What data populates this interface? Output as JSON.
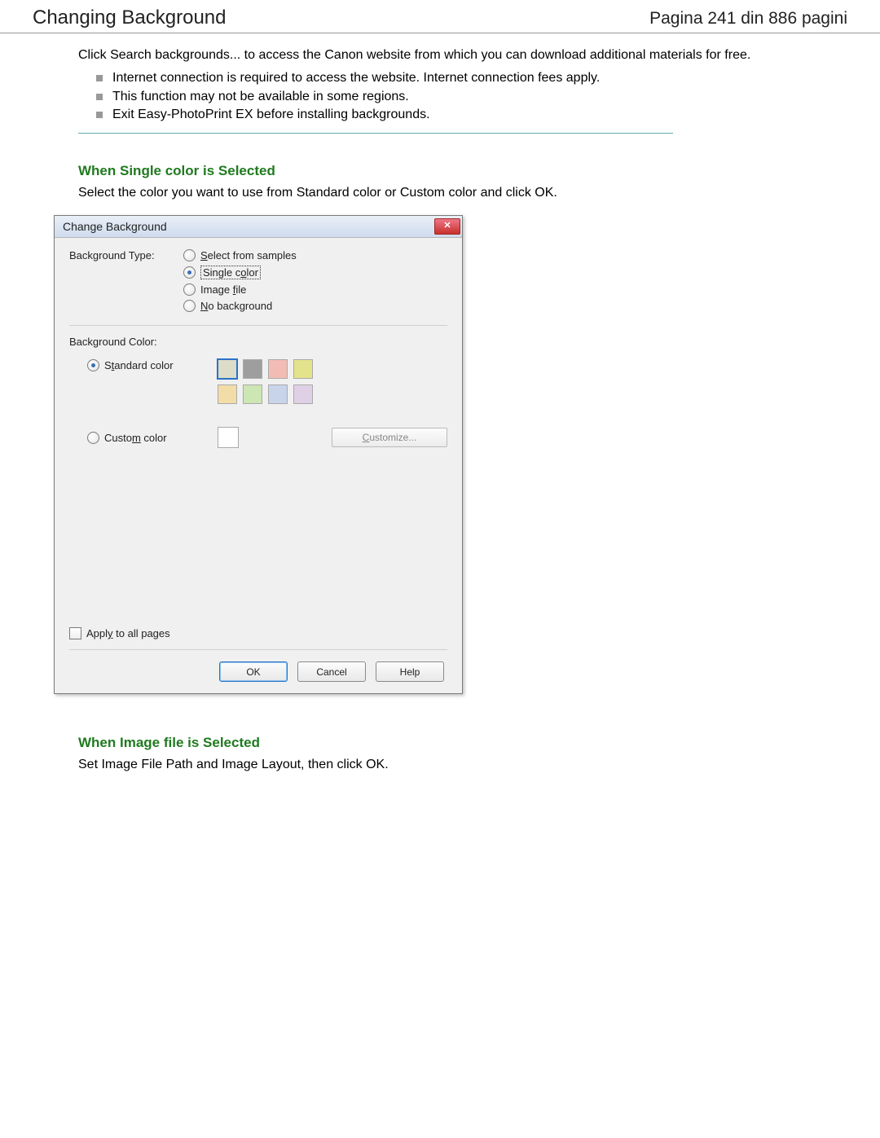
{
  "header": {
    "title": "Changing Background",
    "page_indicator": "Pagina 241 din 886 pagini"
  },
  "intro": "Click Search backgrounds... to access the Canon website from which you can download additional materials for free.",
  "bullets": [
    "Internet connection is required to access the website. Internet connection fees apply.",
    "This function may not be available in some regions.",
    "Exit Easy-PhotoPrint EX before installing backgrounds."
  ],
  "section1": {
    "heading": "When Single color is Selected",
    "body": "Select the color you want to use from Standard color or Custom color and click OK."
  },
  "dialog": {
    "title": "Change Background",
    "close_icon": "x",
    "bg_type_label": "Background Type:",
    "opts": {
      "samples": "Select from samples",
      "single": "Single color",
      "image": "Image file",
      "none": "No background"
    },
    "bg_color_label": "Background Color:",
    "standard_label": "Standard color",
    "standard_colors": [
      "#dcdcc8",
      "#9e9e9e",
      "#f2bcb4",
      "#e3e38c",
      "#f2dca8",
      "#cce6b4",
      "#c8d4ea",
      "#e0d0e6"
    ],
    "custom_label": "Custom color",
    "customize_btn": "Customize...",
    "apply_label": "Apply to all pages",
    "ok": "OK",
    "cancel": "Cancel",
    "help": "Help"
  },
  "section2": {
    "heading": "When Image file is Selected",
    "body": "Set Image File Path and Image Layout, then click OK."
  }
}
